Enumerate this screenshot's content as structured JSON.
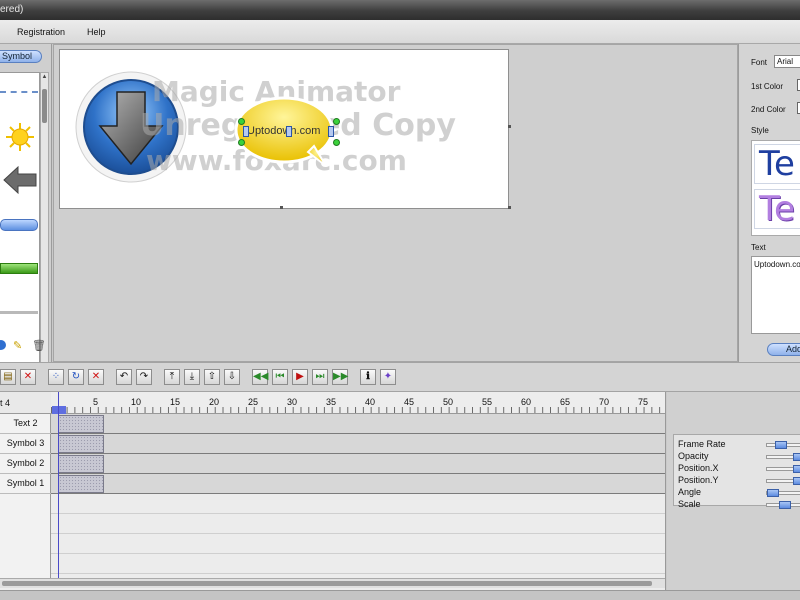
{
  "window": {
    "title_fragment": "ered)"
  },
  "menu": {
    "registration": "Registration",
    "help": "Help"
  },
  "left_panel": {
    "tab_label": "Symbol"
  },
  "stage": {
    "watermark_lines": [
      "Magic Animator",
      "Unregistered Copy",
      "www.foxarc.com"
    ],
    "bubble_text": "Uptodown.com"
  },
  "right_panel": {
    "font_label": "Font",
    "font_value": "Arial",
    "first_color_label": "1st Color",
    "second_color_label": "2nd Color",
    "style_label": "Style",
    "style_samples": [
      "Te",
      "Te"
    ],
    "text_label": "Text",
    "text_value": "Uptodown.co",
    "add_button": "Add"
  },
  "timeline": {
    "header_name": "t 4",
    "ruler_ticks": [
      "5",
      "10",
      "15",
      "20",
      "25",
      "30",
      "35",
      "40",
      "45",
      "50",
      "55",
      "60",
      "65",
      "70",
      "75"
    ],
    "layers": [
      "Text 2",
      "Symbol 3",
      "Symbol 2",
      "Symbol 1"
    ]
  },
  "properties": {
    "frame_rate": {
      "label": "Frame Rate",
      "value": 0.3
    },
    "opacity": {
      "label": "Opacity",
      "value": 1.0
    },
    "position_x": {
      "label": "Position.X",
      "value": 1.0
    },
    "position_y": {
      "label": "Position.Y",
      "value": 1.0
    },
    "angle": {
      "label": "Angle",
      "value": 0.0
    },
    "scale": {
      "label": "Scale",
      "value": 0.45
    }
  },
  "colors": {
    "accent": "#8fb2ea",
    "keyframe": "#c8c8d3",
    "bubble": "#f3d31a",
    "arrow_circle": "#2f72c8"
  }
}
